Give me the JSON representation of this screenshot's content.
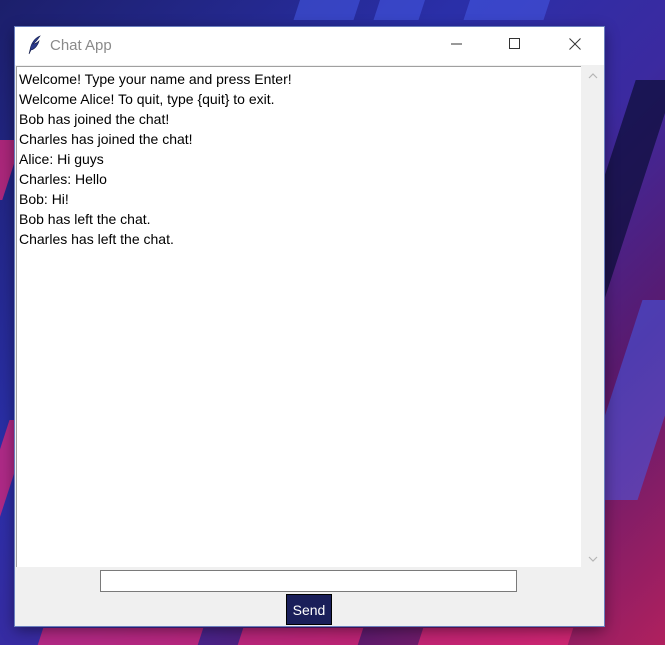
{
  "window": {
    "title": "Chat App",
    "icon": "feather-icon"
  },
  "controls": {
    "minimize_icon": "minimize-icon",
    "maximize_icon": "maximize-icon",
    "close_icon": "close-icon"
  },
  "chat": {
    "messages": [
      "Welcome! Type your name and press Enter!",
      "Welcome Alice! To quit, type {quit} to exit.",
      "Bob has joined the chat!",
      "Charles has joined the chat!",
      "Alice: Hi guys",
      "Charles: Hello",
      "Bob: Hi!",
      "Bob has left the chat.",
      "Charles has left the chat."
    ]
  },
  "input": {
    "value": "",
    "placeholder": ""
  },
  "send": {
    "label": "Send"
  },
  "colors": {
    "send_background": "#1a1f5a",
    "window_background": "#f0f0f0",
    "chat_background": "#ffffff"
  }
}
